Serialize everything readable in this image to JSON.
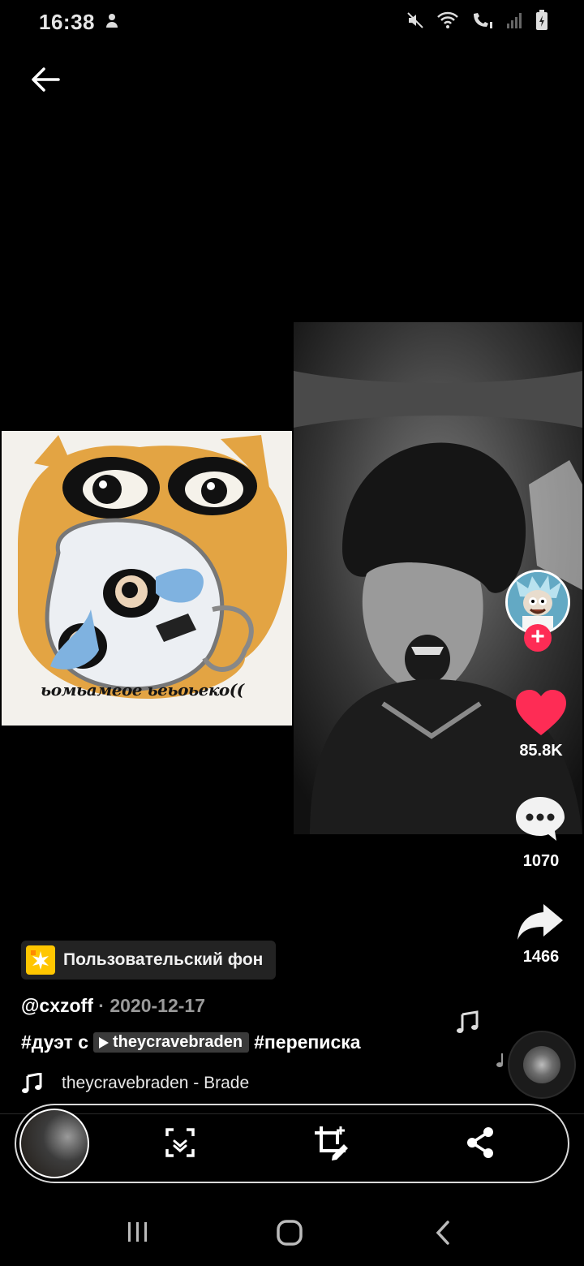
{
  "status_bar": {
    "time": "16:38"
  },
  "post": {
    "sticker_text": "ьомьамеое ьеьоьеко((",
    "likes": "85.8K",
    "comments": "1070",
    "shares": "1466",
    "effect_label": "Пользовательский фон",
    "author": "@cxzoff",
    "date": "· 2020-12-17",
    "hashtag_duet": "#дуэт с",
    "duet_user": "theycravebraden",
    "hashtag_2": "#переписка",
    "music": "theycravebraden - Brade"
  },
  "colors": {
    "like": "#fe2c55",
    "accent_chip": "#ffc600",
    "background": "#000000"
  },
  "icons": [
    "back-arrow-icon",
    "mute-icon",
    "wifi-icon",
    "call-icon",
    "signal-icon",
    "battery-icon",
    "heart-icon",
    "comment-icon",
    "share-icon",
    "music-note-icon",
    "scan-icon",
    "crop-edit-icon",
    "share-node-icon"
  ]
}
